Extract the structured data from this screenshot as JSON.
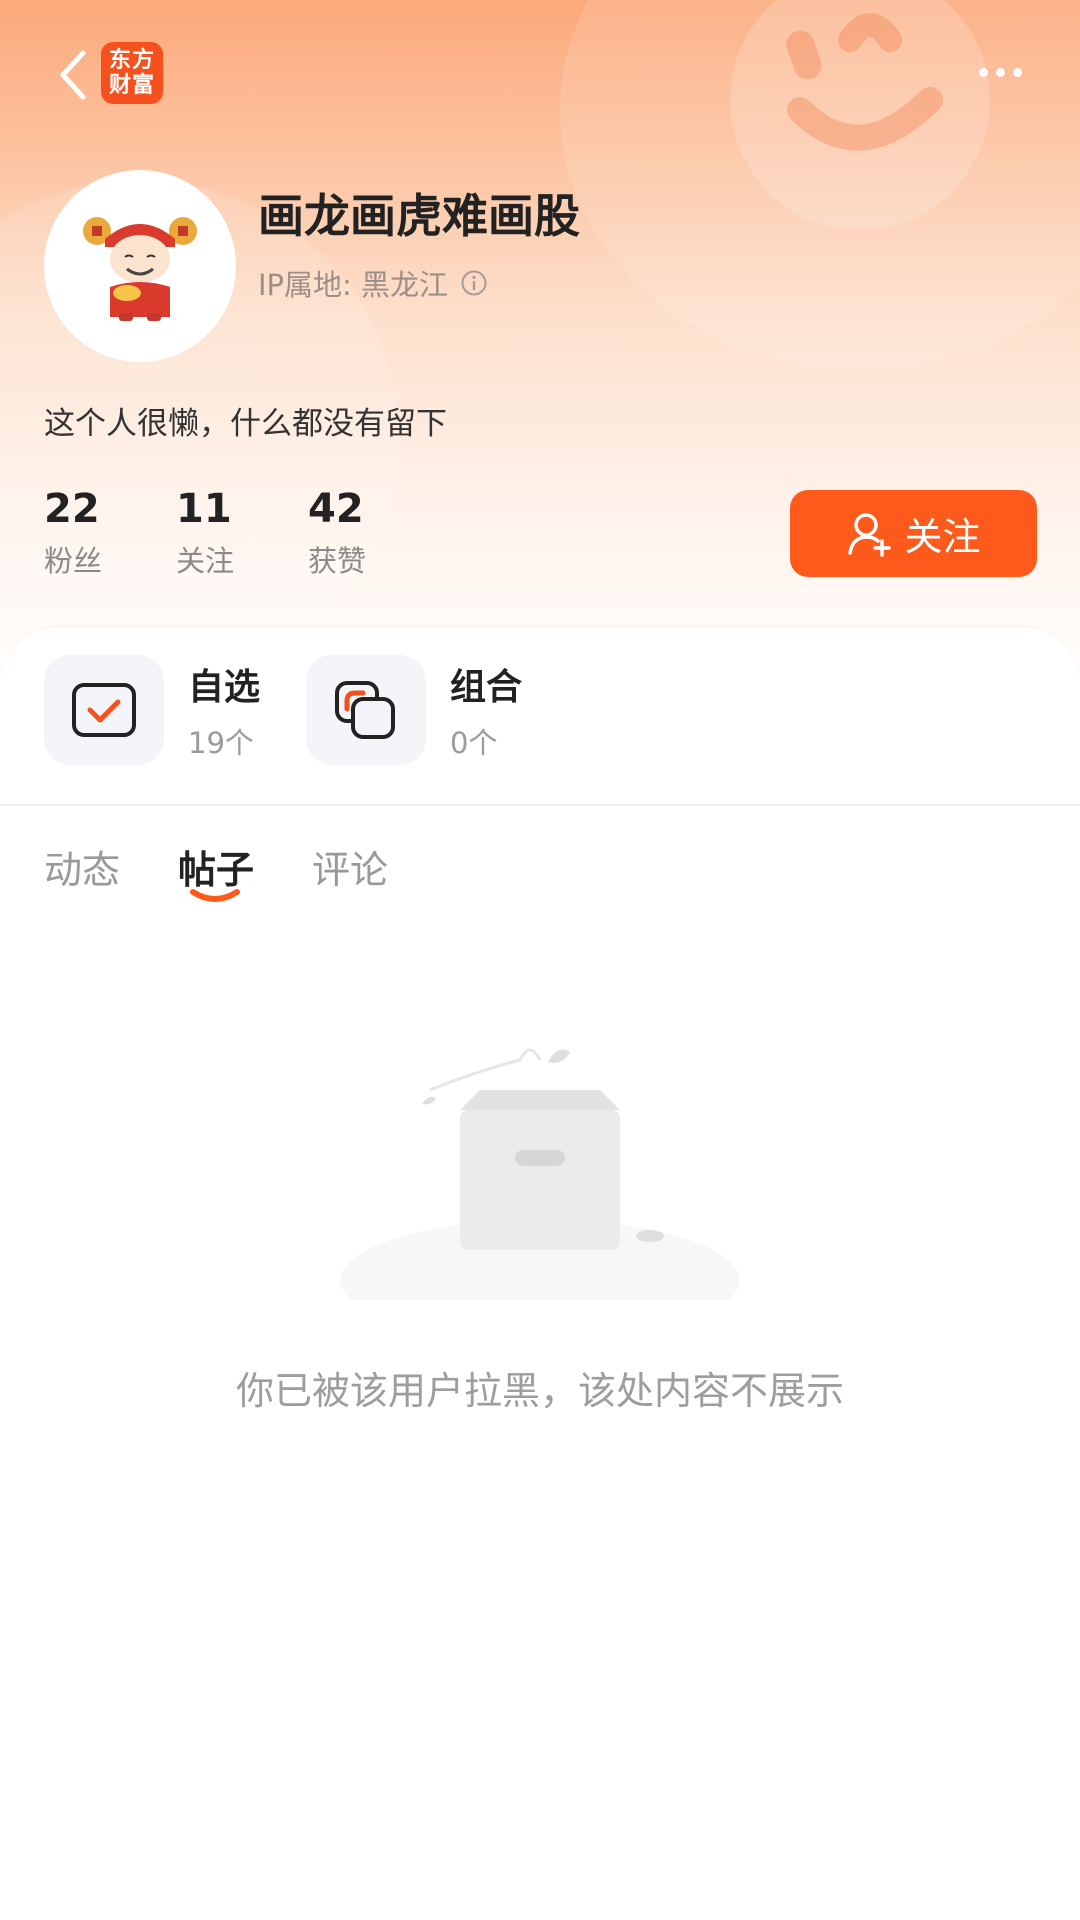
{
  "header": {
    "logo_line1": "东方",
    "logo_line2": "财富",
    "username": "画龙画虎难画股",
    "ip_location": "IP属地: 黑龙江",
    "bio": "这个人很懒，什么都没有留下"
  },
  "stats": [
    {
      "value": "22",
      "label": "粉丝"
    },
    {
      "value": "11",
      "label": "关注"
    },
    {
      "value": "42",
      "label": "获赞"
    }
  ],
  "follow_button": {
    "label": "关注"
  },
  "quick": [
    {
      "title": "自选",
      "count": "19个"
    },
    {
      "title": "组合",
      "count": "0个"
    }
  ],
  "tabs": [
    {
      "label": "动态",
      "active": false
    },
    {
      "label": "帖子",
      "active": true
    },
    {
      "label": "评论",
      "active": false
    }
  ],
  "empty_state": {
    "message": "你已被该用户拉黑，该处内容不展示"
  },
  "colors": {
    "accent": "#fe5a1c",
    "logo_bg": "#f4511e"
  }
}
